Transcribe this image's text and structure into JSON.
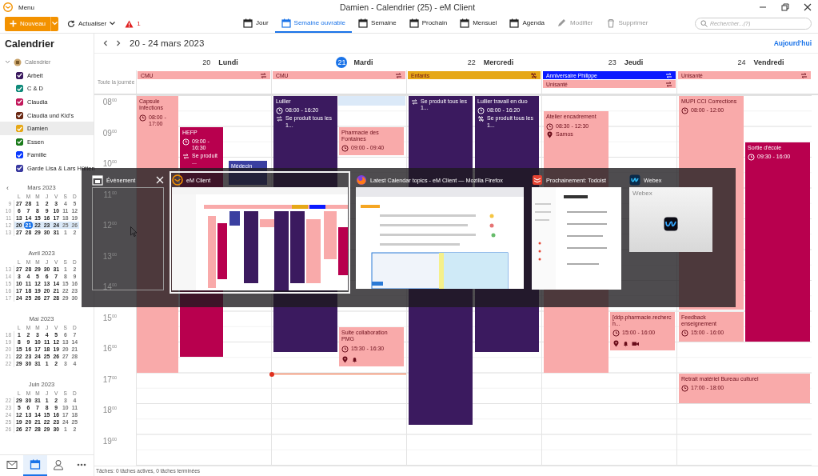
{
  "title_bar": {
    "menu": "Menu",
    "title": "Damien - Calendrier (25) - eM Client"
  },
  "toolbar": {
    "new_button": "Nouveau",
    "refresh_button": "Actualiser",
    "alert_count": "1",
    "views": [
      {
        "kind": "day",
        "label": "Jour",
        "selected": false,
        "disabled": false
      },
      {
        "kind": "workweek",
        "label": "Semaine ouvrable",
        "selected": true,
        "disabled": false
      },
      {
        "kind": "week",
        "label": "Semaine",
        "selected": false,
        "disabled": false
      },
      {
        "kind": "upcoming",
        "label": "Prochain",
        "selected": false,
        "disabled": false
      },
      {
        "kind": "month",
        "label": "Mensuel",
        "selected": false,
        "disabled": false
      },
      {
        "kind": "agenda",
        "label": "Agenda",
        "selected": false,
        "disabled": false
      },
      {
        "kind": "edit",
        "label": "Modifier",
        "selected": false,
        "disabled": true
      },
      {
        "kind": "delete",
        "label": "Supprimer",
        "selected": false,
        "disabled": true
      }
    ],
    "search": {
      "placeholder": "Rechercher...(?)"
    }
  },
  "sidebar": {
    "heading": "Calendrier",
    "tree": {
      "label": "Calendrier",
      "expanded": true,
      "children": [
        {
          "label": "Arbeit",
          "color": "#3b1a5f",
          "checked": true,
          "selected": false
        },
        {
          "label": "C & D",
          "color": "#0f8a7a",
          "checked": true,
          "selected": false
        },
        {
          "label": "Claudia",
          "color": "#c2185b",
          "checked": true,
          "selected": false
        },
        {
          "label": "Claudia und Kid's",
          "color": "#6b2a14",
          "checked": true,
          "selected": false
        },
        {
          "label": "Damien",
          "color": "#e6a817",
          "checked": true,
          "selected": true
        },
        {
          "label": "Essen",
          "color": "#1a7a1a",
          "checked": true,
          "selected": false
        },
        {
          "label": "Famille",
          "color": "#0a3aff",
          "checked": true,
          "selected": false
        },
        {
          "label": "Garde Lisa & Lars Hütten",
          "color": "#3a3aa0",
          "checked": true,
          "selected": false
        }
      ]
    },
    "mini_calendars": [
      {
        "prev": "‹",
        "title": "Mars 2023",
        "weekdays": [
          "L",
          "M",
          "M",
          "J",
          "V",
          "S",
          "D"
        ],
        "weeks": [
          {
            "number": "9",
            "selected": false,
            "days": [
              "27",
              "28",
              "1",
              "2",
              "3",
              "4",
              "5"
            ]
          },
          {
            "number": "10",
            "selected": false,
            "days": [
              "6",
              "7",
              "8",
              "9",
              "10",
              "11",
              "12"
            ]
          },
          {
            "number": "11",
            "selected": false,
            "days": [
              "13",
              "14",
              "15",
              "16",
              "17",
              "18",
              "19"
            ]
          },
          {
            "number": "12",
            "selected": true,
            "days": [
              "20",
              {
                "text": "21",
                "today": true
              },
              "22",
              "23",
              "24",
              "25",
              "26"
            ]
          },
          {
            "number": "13",
            "selected": false,
            "days": [
              "27",
              "28",
              "29",
              "30",
              "31",
              "1",
              "2"
            ]
          }
        ]
      },
      {
        "title": "Avril 2023",
        "weekdays": [
          "L",
          "M",
          "M",
          "J",
          "V",
          "S",
          "D"
        ],
        "weeks": [
          {
            "number": "13",
            "selected": false,
            "days": [
              "27",
              "28",
              "29",
              "30",
              "31",
              "1",
              "2"
            ]
          },
          {
            "number": "14",
            "selected": false,
            "days": [
              "3",
              "4",
              "5",
              "6",
              "7",
              "8",
              "9"
            ]
          },
          {
            "number": "15",
            "selected": false,
            "days": [
              "10",
              "11",
              "12",
              "13",
              "14",
              "15",
              "16"
            ]
          },
          {
            "number": "16",
            "selected": false,
            "days": [
              "17",
              "18",
              "19",
              "20",
              "21",
              "22",
              "23"
            ]
          },
          {
            "number": "17",
            "selected": false,
            "days": [
              "24",
              "25",
              "26",
              "27",
              "28",
              "29",
              "30"
            ]
          }
        ]
      },
      {
        "title": "Mai 2023",
        "weekdays": [
          "L",
          "M",
          "M",
          "J",
          "V",
          "S",
          "D"
        ],
        "weeks": [
          {
            "number": "18",
            "selected": false,
            "days": [
              "1",
              "2",
              "3",
              "4",
              "5",
              "6",
              "7"
            ]
          },
          {
            "number": "19",
            "selected": false,
            "days": [
              "8",
              "9",
              "10",
              "11",
              "12",
              "13",
              "14"
            ]
          },
          {
            "number": "20",
            "selected": false,
            "days": [
              "15",
              "16",
              "17",
              "18",
              "19",
              "20",
              "21"
            ]
          },
          {
            "number": "21",
            "selected": false,
            "days": [
              "22",
              "23",
              "24",
              "25",
              "26",
              "27",
              "28"
            ]
          },
          {
            "number": "22",
            "selected": false,
            "days": [
              "29",
              "30",
              "31",
              "1",
              "2",
              "3",
              "4"
            ]
          }
        ]
      },
      {
        "title": "Juin 2023",
        "weekdays": [
          "L",
          "M",
          "M",
          "J",
          "V",
          "S",
          "D"
        ],
        "weeks": [
          {
            "number": "22",
            "selected": false,
            "days": [
              "29",
              "30",
              "31",
              "1",
              "2",
              "3",
              "4"
            ]
          },
          {
            "number": "23",
            "selected": false,
            "days": [
              "5",
              "6",
              "7",
              "8",
              "9",
              "10",
              "11"
            ]
          },
          {
            "number": "24",
            "selected": false,
            "days": [
              "12",
              "13",
              "14",
              "15",
              "16",
              "17",
              "18"
            ]
          },
          {
            "number": "25",
            "selected": false,
            "days": [
              "19",
              "20",
              "21",
              "22",
              "23",
              "24",
              "25"
            ]
          },
          {
            "number": "26",
            "selected": false,
            "days": [
              "26",
              "27",
              "28",
              "29",
              "30",
              "1",
              "2"
            ]
          }
        ]
      }
    ],
    "nav": [
      {
        "kind": "mail",
        "selected": false
      },
      {
        "kind": "calendar",
        "selected": true
      },
      {
        "kind": "contacts",
        "selected": false
      },
      {
        "kind": "more",
        "selected": false
      }
    ]
  },
  "calendar": {
    "range": "20 - 24 mars 2023",
    "today_button": "Aujourd'hui",
    "all_day_label": "Toute la journée",
    "hours": [
      "08$^{00}$",
      "09$^{00}$",
      "10$^{00}$",
      "11$^{00}$",
      "12$^{00}$",
      "13$^{00}$",
      "14$^{00}$",
      "15$^{00}$",
      "16$^{00}$",
      "17$^{00}$",
      "18$^{00}$",
      "19$^{00}$"
    ],
    "days": [
      {
        "number": "20",
        "name": "Lundi",
        "today": false,
        "selection": false,
        "all_day": [
          {
            "title": "CMU",
            "color": "#f9aaaa",
            "recurring": true,
            "exception": false
          }
        ],
        "events": [
          {
            "title": "Capsule Infections",
            "time": "08:00 - 17:00",
            "color": "#f9aaaa"
          },
          {
            "title": "HEFP",
            "time": "09:00 - 16:30",
            "recurrence": "Se produit ...",
            "exception": false,
            "color": "#b8004e"
          },
          {
            "title": "Médecin",
            "color": "#3a3fa0"
          }
        ]
      },
      {
        "number": "21",
        "name": "Mardi",
        "today": true,
        "selection": true,
        "all_day": [
          {
            "title": "CMU",
            "color": "#f9aaaa",
            "recurring": true,
            "exception": false
          }
        ],
        "events": [
          {
            "title": "Lullier",
            "time": "08:00 - 16:20",
            "recurrence": "Se produit tous les 1...",
            "exception": false,
            "color": "#3b1a5f"
          },
          {
            "title": "Pharmacie des Fontaines",
            "time": "09:00 - 09:40",
            "color": "#f9aaaa"
          },
          {
            "title": "Suite collaboration PMG",
            "time": "15:30 - 16:30",
            "icons": {
              "location": true,
              "reminder": true,
              "video": false
            },
            "color": "#f9aaaa"
          }
        ]
      },
      {
        "number": "22",
        "name": "Mercredi",
        "today": false,
        "selection": false,
        "all_day": [
          {
            "title": "Enfants",
            "color": "#e6a817",
            "recurring": true,
            "exception": true
          }
        ],
        "events": [
          {
            "recurrence": "Se produit tous les 1...",
            "exception": false,
            "color": "#3b1a5f"
          },
          {
            "title": "Lullier travail en duo",
            "time": "08:00 - 16:20",
            "recurrence": "Se produit tous les 1...",
            "exception": true,
            "color": "#3b1a5f"
          }
        ]
      },
      {
        "number": "23",
        "name": "Jeudi",
        "today": false,
        "selection": false,
        "all_day": [
          {
            "title": "Anniversaire Philippe",
            "color": "#0a1aff",
            "recurring": true,
            "exception": false
          },
          {
            "title": "Unisanté",
            "color": "#f9aaaa",
            "recurring": true,
            "exception": false
          }
        ],
        "events": [
          {
            "title": "Atelier encadrement",
            "time": "08:30 - 12:30",
            "location": "Samos",
            "color": "#f9aaaa"
          },
          {
            "title": "[ddp.pharmacie.recherch...",
            "time": "15:00 - 16:00",
            "icons": {
              "location": true,
              "reminder": true,
              "video": true
            },
            "color": "#f9aaaa"
          }
        ]
      },
      {
        "number": "24",
        "name": "Vendredi",
        "today": false,
        "selection": false,
        "all_day": [
          {
            "title": "Unisanté",
            "color": "#f9aaaa",
            "recurring": true,
            "exception": false
          }
        ],
        "events": [
          {
            "title": "MUPI CCI Corrections",
            "time": "08:00 - 12:00",
            "color": "#f9aaaa"
          },
          {
            "title": "Sortie d'école",
            "time": "09:30 - 16:00",
            "color": "#b8004e"
          },
          {
            "title": "Feedback enseignement",
            "time": "15:00 - 16:00",
            "color": "#f9aaaa"
          },
          {
            "title": "Retrait matériel Bureau culturel",
            "time": "17:00 - 18:00",
            "color": "#f9aaaa"
          }
        ]
      }
    ]
  },
  "status_bar": "Tâches: 0 tâches actives, 0 tâches terminées",
  "task_switcher": {
    "windows": [
      {
        "kind": "blank",
        "title": "Événement",
        "selected": false,
        "closable": true
      },
      {
        "kind": "calendar",
        "title": "eM Client",
        "selected": true,
        "closable": false
      },
      {
        "kind": "browser",
        "title": "Latest Calendar topics - eM Client — Mozilla Firefox",
        "selected": false,
        "closable": false
      },
      {
        "kind": "todo",
        "title": "Prochainement: Todoist",
        "selected": false,
        "closable": false
      },
      {
        "kind": "webex",
        "title": "Webex",
        "preview_text": "Webex",
        "selected": false,
        "closable": false
      }
    ]
  }
}
